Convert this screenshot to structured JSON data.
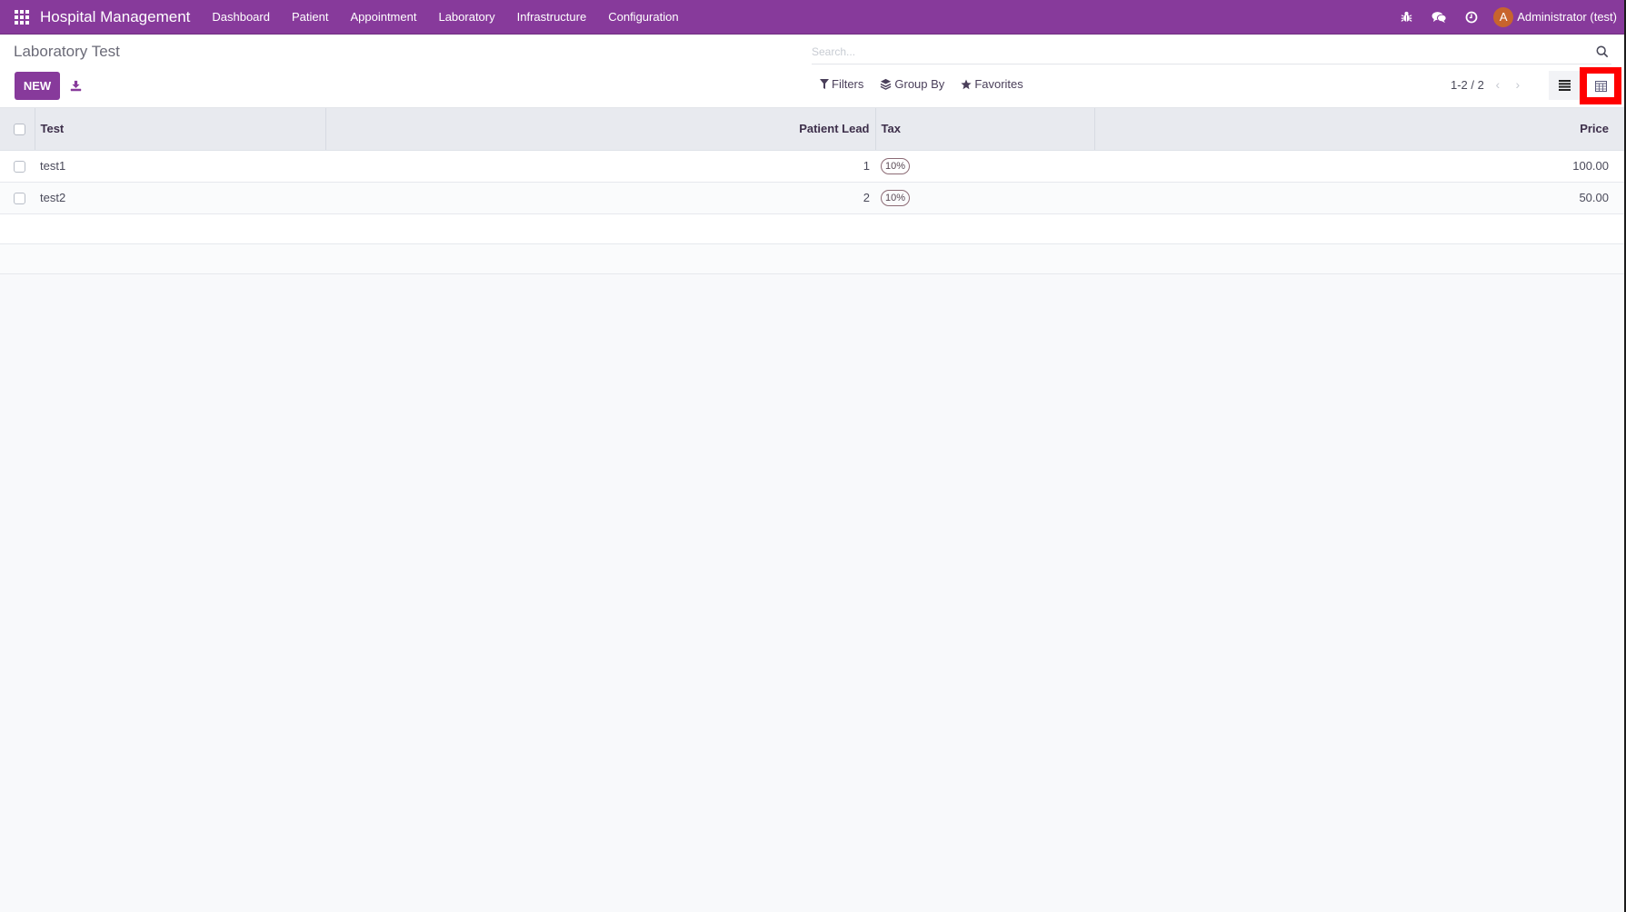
{
  "navbar": {
    "apps_icon": "grid-icon",
    "brand": "Hospital Management",
    "menu": [
      "Dashboard",
      "Patient",
      "Appointment",
      "Laboratory",
      "Infrastructure",
      "Configuration"
    ],
    "icons": [
      "bug-icon",
      "chat-icon",
      "clock-icon"
    ],
    "user": {
      "avatar_letter": "A",
      "avatar_color": "#c8642d",
      "name": "Administrator (test)"
    },
    "color": "#873a9b"
  },
  "control_panel": {
    "title": "Laboratory Test",
    "new_label": "NEW",
    "download_icon": "download-icon",
    "search": {
      "placeholder": "Search...",
      "value": ""
    },
    "filters_label": "Filters",
    "group_by_label": "Group By",
    "favorites_label": "Favorites",
    "pager": {
      "text": "1-2 / 2",
      "prev": "‹",
      "next": "›"
    },
    "views": [
      "list-view-icon",
      "calendar-view-icon"
    ],
    "highlighted_view": "calendar-view-icon"
  },
  "table": {
    "columns": [
      "Test",
      "Patient Lead",
      "Tax",
      "Price"
    ],
    "rows": [
      {
        "test": "test1",
        "patient_lead": "1",
        "tax": "10%",
        "price": "100.00"
      },
      {
        "test": "test2",
        "patient_lead": "2",
        "tax": "10%",
        "price": "50.00"
      }
    ]
  }
}
